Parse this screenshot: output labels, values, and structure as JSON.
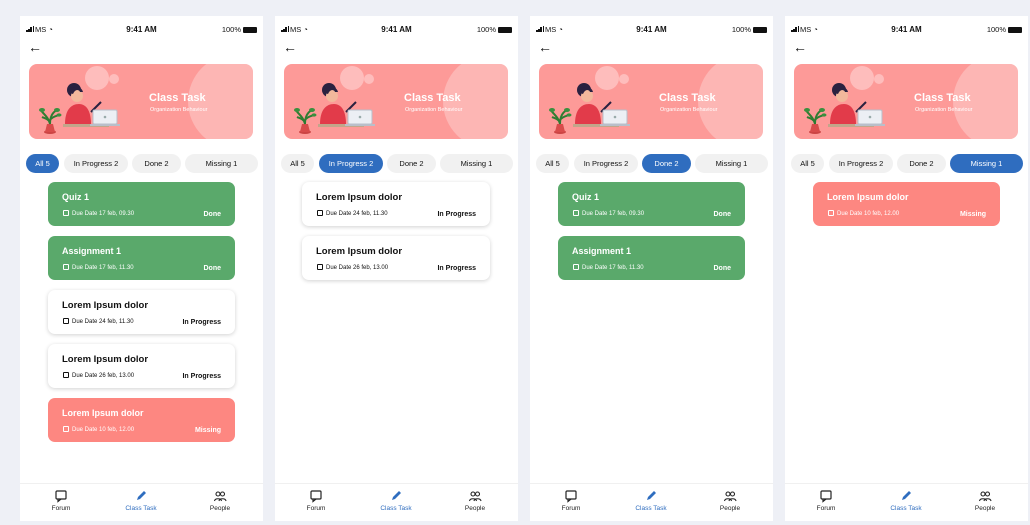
{
  "status": {
    "carrier": "MS",
    "time": "9:41 AM",
    "battery": "100%"
  },
  "banner": {
    "title": "Class Task",
    "subtitle": "Organization Behaviour"
  },
  "tab_labels": {
    "all": "All 5",
    "progress": "In Progress 2",
    "done": "Done 2",
    "missing": "Missing 1"
  },
  "nav": {
    "forum": "Forum",
    "class_task": "Class Task",
    "people": "People"
  },
  "colors": {
    "active_tab": "#2f6dbf",
    "done_card": "#5aa96b",
    "missing_card": "#fd8781",
    "banner": "#fd9a98"
  },
  "screens": [
    {
      "active_tab": "all",
      "tasks": [
        {
          "title": "Quiz 1",
          "due": "Due Date 17 feb, 09.30",
          "status": "Done",
          "kind": "done"
        },
        {
          "title": "Assignment 1",
          "due": "Due Date 17 feb, 11.30",
          "status": "Done",
          "kind": "done"
        },
        {
          "title": "Lorem Ipsum dolor",
          "due": "Due Date 24 feb, 11.30",
          "status": "In Progress",
          "kind": "prog"
        },
        {
          "title": "Lorem Ipsum dolor",
          "due": "Due Date 26 feb, 13.00",
          "status": "In Progress",
          "kind": "prog"
        },
        {
          "title": "Lorem Ipsum dolor",
          "due": "Due Date 10 feb, 12.00",
          "status": "Missing",
          "kind": "miss"
        }
      ]
    },
    {
      "active_tab": "progress",
      "tasks": [
        {
          "title": "Lorem Ipsum dolor",
          "due": "Due Date 24 feb, 11.30",
          "status": "In Progress",
          "kind": "prog"
        },
        {
          "title": "Lorem Ipsum dolor",
          "due": "Due Date 26 feb, 13.00",
          "status": "In Progress",
          "kind": "prog"
        }
      ]
    },
    {
      "active_tab": "done",
      "tasks": [
        {
          "title": "Quiz 1",
          "due": "Due Date 17 feb, 09.30",
          "status": "Done",
          "kind": "done"
        },
        {
          "title": "Assignment 1",
          "due": "Due Date 17 feb, 11.30",
          "status": "Done",
          "kind": "done"
        }
      ]
    },
    {
      "active_tab": "missing",
      "tasks": [
        {
          "title": "Lorem Ipsum dolor",
          "due": "Due Date 10 feb, 12.00",
          "status": "Missing",
          "kind": "miss"
        }
      ]
    }
  ]
}
